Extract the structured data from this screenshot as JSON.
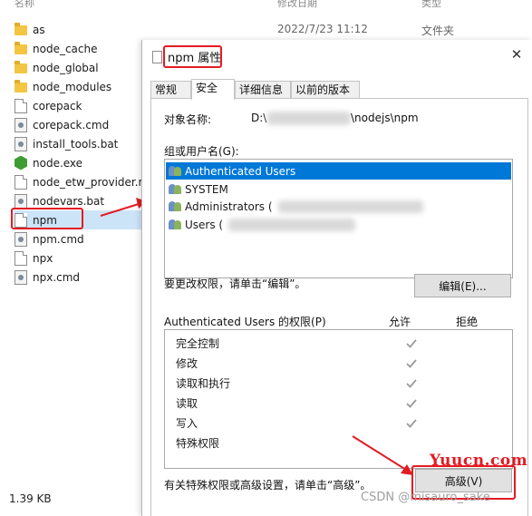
{
  "explorer": {
    "files": [
      {
        "name": "as",
        "icon": "folder-icon"
      },
      {
        "name": "node_cache",
        "icon": "folder-icon"
      },
      {
        "name": "node_global",
        "icon": "folder-icon"
      },
      {
        "name": "node_modules",
        "icon": "folder-icon"
      },
      {
        "name": "corepack",
        "icon": "file-icon"
      },
      {
        "name": "corepack.cmd",
        "icon": "script-file-icon"
      },
      {
        "name": "install_tools.bat",
        "icon": "script-file-icon"
      },
      {
        "name": "node.exe",
        "icon": "node-icon"
      },
      {
        "name": "node_etw_provider.m",
        "icon": "file-icon"
      },
      {
        "name": "nodevars.bat",
        "icon": "script-file-icon"
      },
      {
        "name": "npm",
        "icon": "file-icon"
      },
      {
        "name": "npm.cmd",
        "icon": "script-file-icon"
      },
      {
        "name": "npx",
        "icon": "file-icon"
      },
      {
        "name": "npx.cmd",
        "icon": "script-file-icon"
      }
    ],
    "selected_file": "npm",
    "first_row_date": "2022/7/23 11:12",
    "first_row_type": "文件夹",
    "status_size": "1.39 KB"
  },
  "dialog": {
    "title": "npm 属性",
    "close_glyph": "✕",
    "tabs": [
      {
        "label": "常规"
      },
      {
        "label": "安全",
        "active": true
      },
      {
        "label": "详细信息"
      },
      {
        "label": "以前的版本"
      }
    ],
    "object_name_label": "对象名称:",
    "object_name_prefix": "D:\\",
    "object_name_suffix": "\\nodejs\\npm",
    "group_label": "组或用户名(G):",
    "groups": [
      {
        "name": "Authenticated Users",
        "selected": true
      },
      {
        "name": "SYSTEM"
      },
      {
        "name": "Administrators ("
      },
      {
        "name": "Users ("
      }
    ],
    "change_hint": "要更改权限，请单击“编辑”。",
    "edit_button": "编辑(E)...",
    "perm_header": "Authenticated Users 的权限(P)",
    "allow_header": "允许",
    "deny_header": "拒绝",
    "permissions": [
      {
        "name": "完全控制",
        "allow": true
      },
      {
        "name": "修改",
        "allow": true
      },
      {
        "name": "读取和执行",
        "allow": true
      },
      {
        "name": "读取",
        "allow": true
      },
      {
        "name": "写入",
        "allow": true
      },
      {
        "name": "特殊权限",
        "allow": false
      }
    ],
    "advanced_hint": "有关特殊权限或高级设置，请单击“高级”。",
    "advanced_button": "高级(V)"
  },
  "watermarks": {
    "site": "Yuucn.com",
    "csdn": "CSDN @misauro_sake"
  }
}
